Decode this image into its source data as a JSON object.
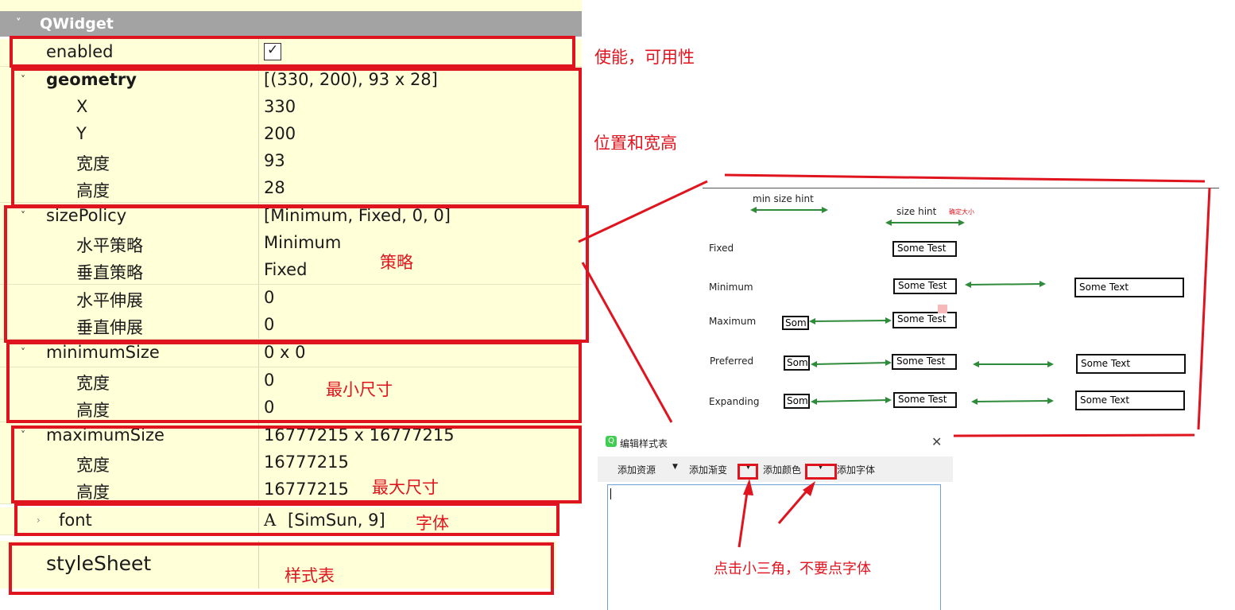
{
  "property_editor": {
    "group_title": "QWidget",
    "rows": [
      {
        "name": "enabled",
        "value": ""
      },
      {
        "name": "geometry",
        "value": "[(330, 200), 93 x 28]"
      },
      {
        "name": "X",
        "value": "330"
      },
      {
        "name": "Y",
        "value": "200"
      },
      {
        "name": "宽度",
        "value": "93"
      },
      {
        "name": "高度",
        "value": "28"
      },
      {
        "name": "sizePolicy",
        "value": "[Minimum, Fixed, 0, 0]"
      },
      {
        "name": "水平策略",
        "value": "Minimum"
      },
      {
        "name": "垂直策略",
        "value": "Fixed"
      },
      {
        "name": "水平伸展",
        "value": "0"
      },
      {
        "name": "垂直伸展",
        "value": "0"
      },
      {
        "name": "minimumSize",
        "value": "0 x 0"
      },
      {
        "name": "宽度",
        "value": "0"
      },
      {
        "name": "高度",
        "value": "0"
      },
      {
        "name": "maximumSize",
        "value": "16777215 x 16777215"
      },
      {
        "name": "宽度",
        "value": "16777215"
      },
      {
        "name": "高度",
        "value": "16777215"
      },
      {
        "name": "font",
        "value": "[SimSun, 9]"
      },
      {
        "name": "styleSheet",
        "value": ""
      }
    ],
    "enabled_checked": true,
    "font_icon_glyph": "A"
  },
  "annotations": {
    "enabled": "使能，可用性",
    "geometry": "位置和宽高",
    "size_policy": "策略",
    "minimum_size": "最小尺寸",
    "maximum_size": "最大尺寸",
    "font": "字体",
    "style_sheet": "样式表",
    "dialog_tip": "点击小三角，不要点字体"
  },
  "size_policy_diagram": {
    "min_size_hint": "min  size   hint",
    "size_hint": "size hint",
    "size_hint_note": "确定大小",
    "rows": [
      {
        "label": "Fixed",
        "buttons": [
          "Some Test"
        ]
      },
      {
        "label": "Minimum",
        "buttons": [
          "Some Test",
          "Some Text"
        ]
      },
      {
        "label": "Maximum",
        "buttons": [
          "Som",
          "Some Test"
        ]
      },
      {
        "label": "Preferred",
        "buttons": [
          "Som",
          "Some Test",
          "Some Text"
        ]
      },
      {
        "label": "Expanding",
        "buttons": [
          "Som",
          "Some Test",
          "Some Text"
        ]
      }
    ],
    "colors": {
      "arrow": "#2e8b3a",
      "annotation": "#e0141e"
    }
  },
  "style_sheet_dialog": {
    "title": "编辑样式表",
    "icon": "qt-icon",
    "toolbar": [
      "添加资源",
      "添加渐变",
      "添加颜色",
      "添加字体"
    ]
  }
}
